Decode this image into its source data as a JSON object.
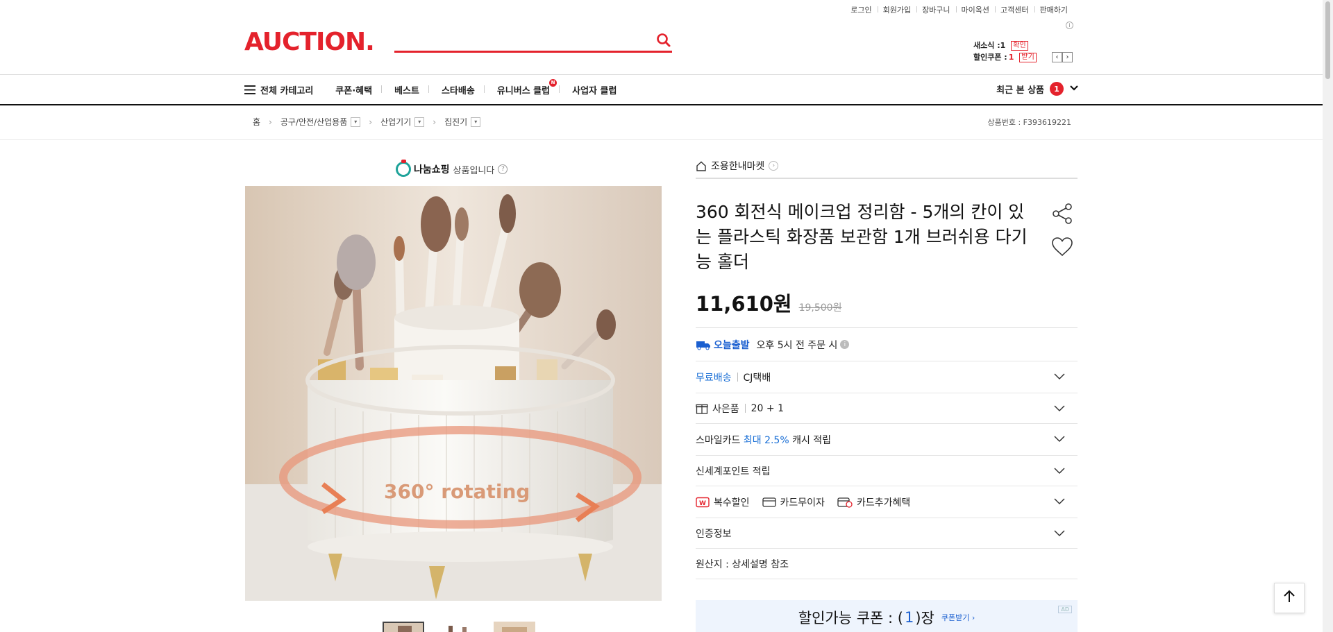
{
  "util_links": [
    "로그인",
    "회원가입",
    "장바구니",
    "마이옥션",
    "고객센터",
    "판매하기"
  ],
  "util_info": "i",
  "logo": "AUCTION.",
  "search": {
    "value": "",
    "placeholder": ""
  },
  "mini": {
    "new_label": "새소식 :",
    "new_count": "1",
    "new_btn": "확인",
    "coupon_label": "할인쿠폰 :",
    "coupon_count": "1",
    "coupon_btn": "받기"
  },
  "nav": {
    "all_categories": "전체 카테고리",
    "menus": [
      "쿠폰·혜택",
      "베스트",
      "스타배송",
      "유니버스 클럽",
      "사업자 클럽"
    ],
    "universe_badge": "N",
    "recent_label": "최근 본 상품",
    "recent_count": "1"
  },
  "breadcrumb": [
    "홈",
    "공구/안전/산업용품",
    "산업기기",
    "집진기"
  ],
  "product_no": "상품번호 : F393619221",
  "nanum": {
    "brand": "나눔쇼핑",
    "text": "상품입니다",
    "help": "?"
  },
  "image_caption": "360° rotating",
  "seller": "조용한내마켓",
  "title": "360 회전식 메이크업 정리함 - 5개의 칸이 있는 플라스틱 화장품 보관함 1개 브러쉬용 다기능 홀더",
  "price": {
    "current": "11,610원",
    "original": "19,500원"
  },
  "rows": {
    "today_label": "오늘출발",
    "today_text": "오후 5시 전 주문 시",
    "free_ship": "무료배송",
    "courier": "CJ택배",
    "gift_label": "사은품",
    "gift_value": "20 + 1",
    "smile_prefix": "스마일카드",
    "smile_highlight": "최대 2.5%",
    "smile_suffix": "캐시 적립",
    "shinsegae": "신세계포인트 적립",
    "multi_discount": "복수할인",
    "card_nointerest": "카드무이자",
    "card_extra": "카드추가혜택",
    "certification": "인증정보",
    "origin": "원산지 : 상세설명 참조"
  },
  "coupon": {
    "prefix": "할인가능 쿠폰 : (",
    "count": "1",
    "suffix": ")장",
    "get": "쿠폰받기 ›",
    "ad": "AD"
  },
  "colors": {
    "brand": "#e4222c",
    "accent_blue": "#1a5fd0",
    "coupon_bg": "#eef4fd"
  }
}
